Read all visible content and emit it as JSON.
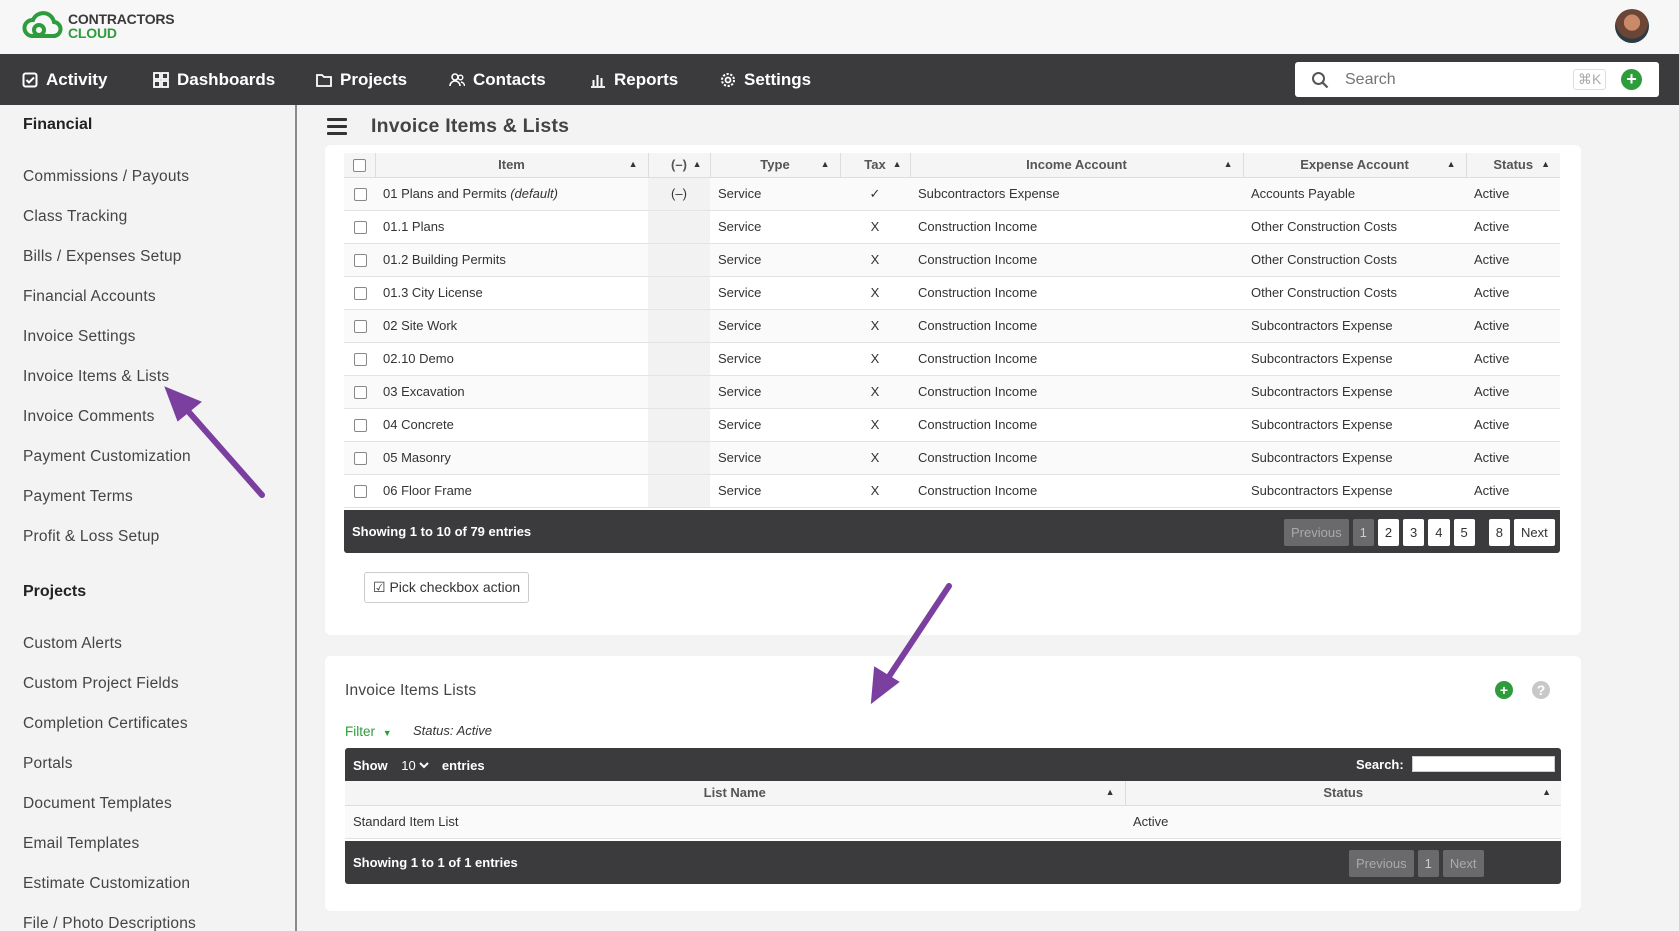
{
  "brand": {
    "line1": "CONTRACTORS",
    "line2": "CLOUD"
  },
  "nav": {
    "items": [
      {
        "label": "Activity"
      },
      {
        "label": "Dashboards"
      },
      {
        "label": "Projects"
      },
      {
        "label": "Contacts"
      },
      {
        "label": "Reports"
      },
      {
        "label": "Settings"
      }
    ],
    "search_placeholder": "Search",
    "search_shortcut": "⌘K"
  },
  "sidebar": {
    "financial_heading": "Financial",
    "financial_items": [
      "Commissions / Payouts",
      "Class Tracking",
      "Bills / Expenses Setup",
      "Financial Accounts",
      "Invoice Settings",
      "Invoice Items & Lists",
      "Invoice Comments",
      "Payment Customization",
      "Payment Terms",
      "Profit & Loss Setup"
    ],
    "projects_heading": "Projects",
    "projects_items": [
      "Custom Alerts",
      "Custom Project Fields",
      "Completion Certificates",
      "Portals",
      "Document Templates",
      "Email Templates",
      "Estimate Customization",
      "File / Photo Descriptions"
    ]
  },
  "page": {
    "title": "Invoice Items & Lists"
  },
  "items_table": {
    "columns": [
      "Item",
      "(–)",
      "Type",
      "Tax",
      "Income Account",
      "Expense Account",
      "Status"
    ],
    "rows": [
      {
        "item": "01 Plans and Permits",
        "item_note": "(default)",
        "dash": "(–)",
        "type": "Service",
        "tax": "✓",
        "income": "Subcontractors Expense",
        "expense": "Accounts Payable",
        "status": "Active"
      },
      {
        "item": "01.1 Plans",
        "item_note": "",
        "dash": "",
        "type": "Service",
        "tax": "X",
        "income": "Construction Income",
        "expense": "Other Construction Costs",
        "status": "Active"
      },
      {
        "item": "01.2 Building Permits",
        "item_note": "",
        "dash": "",
        "type": "Service",
        "tax": "X",
        "income": "Construction Income",
        "expense": "Other Construction Costs",
        "status": "Active"
      },
      {
        "item": "01.3 City License",
        "item_note": "",
        "dash": "",
        "type": "Service",
        "tax": "X",
        "income": "Construction Income",
        "expense": "Other Construction Costs",
        "status": "Active"
      },
      {
        "item": "02 Site Work",
        "item_note": "",
        "dash": "",
        "type": "Service",
        "tax": "X",
        "income": "Construction Income",
        "expense": "Subcontractors Expense",
        "status": "Active"
      },
      {
        "item": "02.10 Demo",
        "item_note": "",
        "dash": "",
        "type": "Service",
        "tax": "X",
        "income": "Construction Income",
        "expense": "Subcontractors Expense",
        "status": "Active"
      },
      {
        "item": "03 Excavation",
        "item_note": "",
        "dash": "",
        "type": "Service",
        "tax": "X",
        "income": "Construction Income",
        "expense": "Subcontractors Expense",
        "status": "Active"
      },
      {
        "item": "04 Concrete",
        "item_note": "",
        "dash": "",
        "type": "Service",
        "tax": "X",
        "income": "Construction Income",
        "expense": "Subcontractors Expense",
        "status": "Active"
      },
      {
        "item": "05 Masonry",
        "item_note": "",
        "dash": "",
        "type": "Service",
        "tax": "X",
        "income": "Construction Income",
        "expense": "Subcontractors Expense",
        "status": "Active"
      },
      {
        "item": "06 Floor Frame",
        "item_note": "",
        "dash": "",
        "type": "Service",
        "tax": "X",
        "income": "Construction Income",
        "expense": "Subcontractors Expense",
        "status": "Active"
      }
    ],
    "footer_info": "Showing 1 to 10 of 79 entries",
    "pager": {
      "previous": "Previous",
      "pages": [
        "1",
        "2",
        "3",
        "4",
        "5"
      ],
      "last": "8",
      "next": "Next"
    },
    "action_button": "Pick checkbox action"
  },
  "lists_section": {
    "title": "Invoice Items Lists",
    "filter_label": "Filter",
    "filter_status": "Status: Active",
    "show_label": "Show",
    "show_value": "10",
    "entries_label": "entries",
    "search_label": "Search:",
    "columns": [
      "List Name",
      "Status"
    ],
    "rows": [
      {
        "name": "Standard Item List",
        "status": "Active"
      }
    ],
    "footer_info": "Showing 1 to 1 of 1 entries",
    "pager": {
      "previous": "Previous",
      "page": "1",
      "next": "Next"
    }
  },
  "colors": {
    "accent_green": "#2e9c3c",
    "nav_dark": "#3b3b3d",
    "tax_red": "#d0021b",
    "arrow_purple": "#7b3fa0"
  }
}
